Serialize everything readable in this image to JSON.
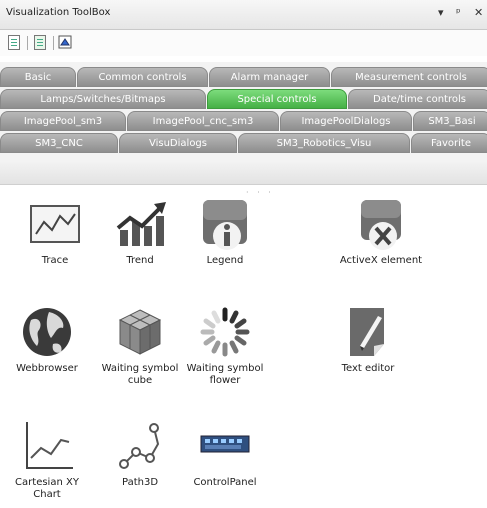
{
  "window": {
    "title": "Visualization ToolBox",
    "controls": [
      "▾",
      "ᵖ",
      "✕"
    ]
  },
  "toolbar": {
    "buttons": [
      {
        "name": "list-view"
      },
      {
        "name": "detail-view"
      },
      {
        "name": "icon-view"
      }
    ]
  },
  "tabs": {
    "row1": [
      "Basic",
      "Common controls",
      "Alarm manager",
      "Measurement controls"
    ],
    "row2": [
      "Lamps/Switches/Bitmaps",
      "Special controls",
      "Date/time controls"
    ],
    "row3": [
      "ImagePool_sm3",
      "ImagePool_cnc_sm3",
      "ImagePoolDialogs",
      "SM3_Basi"
    ],
    "row4": [
      "SM3_CNC",
      "VisuDialogs",
      "SM3_Robotics_Visu",
      "Favorite"
    ],
    "active": "Special controls"
  },
  "items": [
    {
      "label": "Trace",
      "icon": "trace-icon"
    },
    {
      "label": "Trend",
      "icon": "trend-icon"
    },
    {
      "label": "Legend",
      "icon": "legend-icon"
    },
    {
      "label": "ActiveX element",
      "icon": "activex-icon"
    },
    {
      "label": "Webbrowser",
      "icon": "globe-icon"
    },
    {
      "label": "Waiting symbol cube",
      "icon": "cube-icon"
    },
    {
      "label": "Waiting symbol flower",
      "icon": "spinner-icon"
    },
    {
      "label": "Text editor",
      "icon": "text-editor-icon"
    },
    {
      "label": "Cartesian XY Chart",
      "icon": "cartesian-chart-icon"
    },
    {
      "label": "Path3D",
      "icon": "path3d-icon"
    },
    {
      "label": "ControlPanel",
      "icon": "control-panel-icon"
    }
  ],
  "colors": {
    "tab": "#9c9c9c",
    "tab_active": "#4fbf4f",
    "text": "#222222"
  }
}
